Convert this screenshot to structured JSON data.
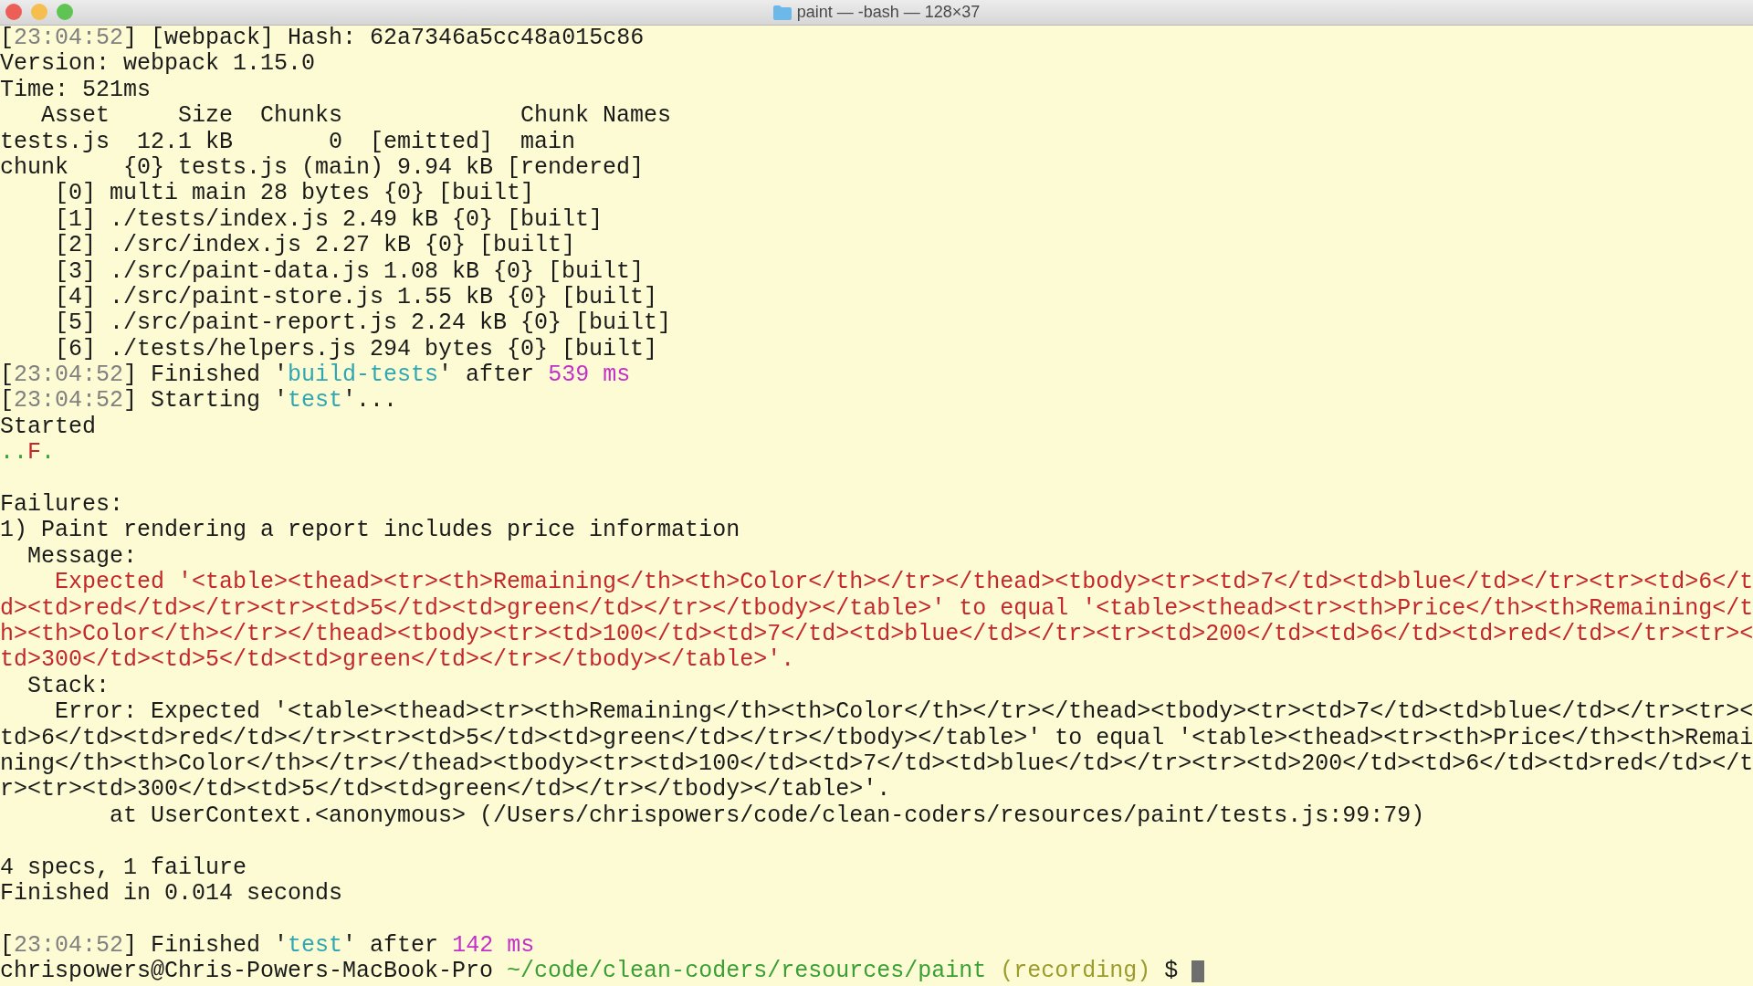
{
  "window": {
    "title": "paint — -bash — 128×37"
  },
  "lines": [
    {
      "segments": [
        {
          "kind": "text",
          "text": "["
        },
        {
          "kind": "dim",
          "text": "23:04:52"
        },
        {
          "kind": "text",
          "text": "] [webpack] Hash: 62a7346a5cc48a015c86"
        }
      ]
    },
    {
      "segments": [
        {
          "kind": "text",
          "text": "Version: webpack 1.15.0"
        }
      ]
    },
    {
      "segments": [
        {
          "kind": "text",
          "text": "Time: 521ms"
        }
      ]
    },
    {
      "segments": [
        {
          "kind": "text",
          "text": "   Asset     Size  Chunks             Chunk Names"
        }
      ]
    },
    {
      "segments": [
        {
          "kind": "text",
          "text": "tests.js  12.1 kB       0  [emitted]  main"
        }
      ]
    },
    {
      "segments": [
        {
          "kind": "text",
          "text": "chunk    {0} tests.js (main) 9.94 kB [rendered]"
        }
      ]
    },
    {
      "segments": [
        {
          "kind": "text",
          "text": "    [0] multi main 28 bytes {0} [built]"
        }
      ]
    },
    {
      "segments": [
        {
          "kind": "text",
          "text": "    [1] ./tests/index.js 2.49 kB {0} [built]"
        }
      ]
    },
    {
      "segments": [
        {
          "kind": "text",
          "text": "    [2] ./src/index.js 2.27 kB {0} [built]"
        }
      ]
    },
    {
      "segments": [
        {
          "kind": "text",
          "text": "    [3] ./src/paint-data.js 1.08 kB {0} [built]"
        }
      ]
    },
    {
      "segments": [
        {
          "kind": "text",
          "text": "    [4] ./src/paint-store.js 1.55 kB {0} [built]"
        }
      ]
    },
    {
      "segments": [
        {
          "kind": "text",
          "text": "    [5] ./src/paint-report.js 2.24 kB {0} [built]"
        }
      ]
    },
    {
      "segments": [
        {
          "kind": "text",
          "text": "    [6] ./tests/helpers.js 294 bytes {0} [built]"
        }
      ]
    },
    {
      "segments": [
        {
          "kind": "text",
          "text": "["
        },
        {
          "kind": "dim",
          "text": "23:04:52"
        },
        {
          "kind": "text",
          "text": "] Finished '"
        },
        {
          "kind": "cyan",
          "text": "build-tests"
        },
        {
          "kind": "text",
          "text": "' after "
        },
        {
          "kind": "magenta",
          "text": "539 ms"
        }
      ]
    },
    {
      "segments": [
        {
          "kind": "text",
          "text": "["
        },
        {
          "kind": "dim",
          "text": "23:04:52"
        },
        {
          "kind": "text",
          "text": "] Starting '"
        },
        {
          "kind": "cyan",
          "text": "test"
        },
        {
          "kind": "text",
          "text": "'..."
        }
      ]
    },
    {
      "segments": [
        {
          "kind": "text",
          "text": "Started"
        }
      ]
    },
    {
      "segments": [
        {
          "kind": "green",
          "text": ".."
        },
        {
          "kind": "red",
          "text": "F"
        },
        {
          "kind": "green",
          "text": "."
        }
      ]
    },
    {
      "segments": [
        {
          "kind": "text",
          "text": "Failures:"
        }
      ],
      "blank_before": true
    },
    {
      "segments": [
        {
          "kind": "text",
          "text": "1) Paint rendering a report includes price information"
        }
      ]
    },
    {
      "segments": [
        {
          "kind": "text",
          "text": "  Message:"
        }
      ]
    },
    {
      "segments": [
        {
          "kind": "red",
          "text": "    Expected '<table><thead><tr><th>Remaining</th><th>Color</th></tr></thead><tbody><tr><td>7</td><td>blue</td></tr><tr><td>6</t"
        }
      ]
    },
    {
      "segments": [
        {
          "kind": "red",
          "text": "d><td>red</td></tr><tr><td>5</td><td>green</td></tr></tbody></table>' to equal '<table><thead><tr><th>Price</th><th>Remaining</t"
        }
      ]
    },
    {
      "segments": [
        {
          "kind": "red",
          "text": "h><th>Color</th></tr></thead><tbody><tr><td>100</td><td>7</td><td>blue</td></tr><tr><td>200</td><td>6</td><td>red</td></tr><tr><"
        }
      ]
    },
    {
      "segments": [
        {
          "kind": "red",
          "text": "td>300</td><td>5</td><td>green</td></tr></tbody></table>'."
        }
      ]
    },
    {
      "segments": [
        {
          "kind": "text",
          "text": "  Stack:"
        }
      ]
    },
    {
      "segments": [
        {
          "kind": "text",
          "text": "    Error: Expected '<table><thead><tr><th>Remaining</th><th>Color</th></tr></thead><tbody><tr><td>7</td><td>blue</td></tr><tr><"
        }
      ]
    },
    {
      "segments": [
        {
          "kind": "text",
          "text": "td>6</td><td>red</td></tr><tr><td>5</td><td>green</td></tr></tbody></table>' to equal '<table><thead><tr><th>Price</th><th>Remai"
        }
      ]
    },
    {
      "segments": [
        {
          "kind": "text",
          "text": "ning</th><th>Color</th></tr></thead><tbody><tr><td>100</td><td>7</td><td>blue</td></tr><tr><td>200</td><td>6</td><td>red</td></t"
        }
      ]
    },
    {
      "segments": [
        {
          "kind": "text",
          "text": "r><tr><td>300</td><td>5</td><td>green</td></tr></tbody></table>'."
        }
      ]
    },
    {
      "segments": [
        {
          "kind": "text",
          "text": "        at UserContext.<anonymous> (/Users/chrispowers/code/clean-coders/resources/paint/tests.js:99:79)"
        }
      ]
    },
    {
      "segments": [
        {
          "kind": "text",
          "text": "4 specs, 1 failure"
        }
      ],
      "blank_before": true
    },
    {
      "segments": [
        {
          "kind": "text",
          "text": "Finished in 0.014 seconds"
        }
      ]
    },
    {
      "segments": [
        {
          "kind": "text",
          "text": "["
        },
        {
          "kind": "dim",
          "text": "23:04:52"
        },
        {
          "kind": "text",
          "text": "] Finished '"
        },
        {
          "kind": "cyan",
          "text": "test"
        },
        {
          "kind": "text",
          "text": "' after "
        },
        {
          "kind": "magenta",
          "text": "142 ms"
        }
      ],
      "blank_before": true
    },
    {
      "segments": [
        {
          "kind": "text",
          "text": "chrispowers@Chris-Powers-MacBook-Pro "
        },
        {
          "kind": "green",
          "text": "~/code/clean-coders/resources/paint"
        },
        {
          "kind": "olive",
          "text": " (recording)"
        },
        {
          "kind": "text",
          "text": " $ "
        }
      ],
      "cursor": true
    }
  ]
}
